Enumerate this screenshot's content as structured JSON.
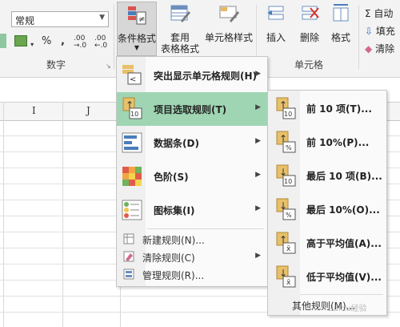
{
  "ribbon": {
    "number_format_value": "常规",
    "number_symbols": {
      "currency": "$",
      "percent": "%",
      "comma": ",",
      "inc_decimal": ".00 →.0",
      "dec_decimal": ".00 ←.0"
    },
    "number_group_label": "数字",
    "cells_group_label": "单元格",
    "buttons": {
      "conditional_format": "条件格式",
      "table_format_line1": "套用",
      "table_format_line2": "表格格式",
      "cell_style": "单元格样式",
      "insert": "插入",
      "delete": "删除",
      "format": "格式"
    },
    "right": {
      "autosum": "Σ 自动",
      "fill": "填充",
      "clear": "清除"
    }
  },
  "sheet": {
    "columns": [
      "I",
      "J"
    ]
  },
  "menu": {
    "items": [
      {
        "label": "突出显示单元格规则(H)",
        "icon": "highlight-rules-icon"
      },
      {
        "label": "项目选取规则(T)",
        "icon": "top-bottom-rules-icon"
      },
      {
        "label": "数据条(D)",
        "icon": "data-bars-icon"
      },
      {
        "label": "色阶(S)",
        "icon": "color-scales-icon"
      },
      {
        "label": "图标集(I)",
        "icon": "icon-sets-icon"
      }
    ],
    "small_items": [
      {
        "label": "新建规则(N)...",
        "icon": "new-rule-icon"
      },
      {
        "label": "清除规则(C)",
        "icon": "clear-rules-icon"
      },
      {
        "label": "管理规则(R)...",
        "icon": "manage-rules-icon"
      }
    ]
  },
  "submenu": {
    "items": [
      {
        "label": "前 10 项(T)...",
        "badge": "10",
        "arrow": "↑"
      },
      {
        "label": "前 10%(P)...",
        "badge": "%",
        "arrow": "↑"
      },
      {
        "label": "最后 10 项(B)...",
        "badge": "10",
        "arrow": "↓"
      },
      {
        "label": "最后 10%(O)...",
        "badge": "%",
        "arrow": "↓"
      },
      {
        "label": "高于平均值(A)...",
        "badge": "x̄",
        "arrow": "↑"
      },
      {
        "label": "低于平均值(V)...",
        "badge": "x̄",
        "arrow": "↓"
      }
    ],
    "more_label": "其他规则(M)..."
  },
  "watermark": "Baidu经验",
  "colors": {
    "accent_green": "#9fd5b3",
    "ribbon_bg": "#f3f3f3"
  }
}
